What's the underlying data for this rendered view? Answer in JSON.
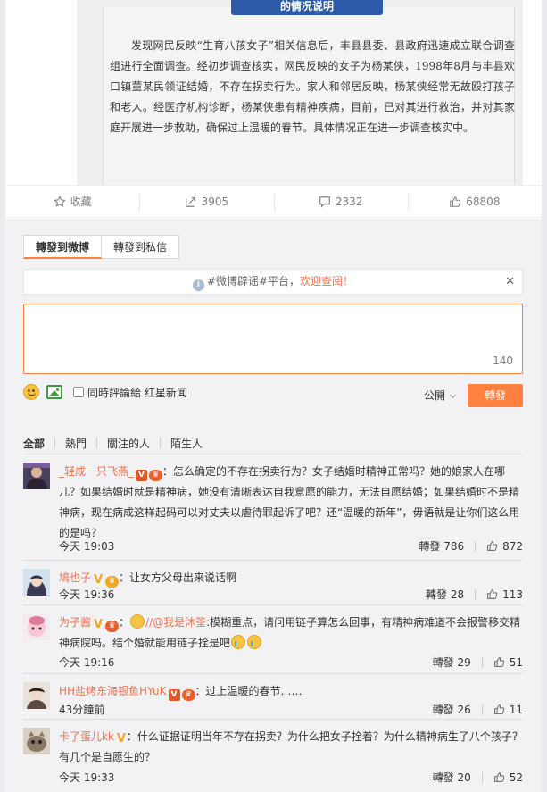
{
  "article_image": {
    "banner": "的情况说明",
    "text": "发现网民反映“生育八孩女子”相关信息后，丰县县委、县政府迅速成立联合调查组进行全面调查。经初步调查核实，网民反映的女子为杨某侠，1998年8月与丰县欢口镇董某民领证结婚，不存在拐卖行为。家人和邻居反映，杨某侠经常无故殴打孩子和老人。经医疗机构诊断，杨某侠患有精神疾病，目前，已对其进行救治，并对其家庭开展进一步救助，确保过上温暖的春节。具体情况正在进一步调查核实中。"
  },
  "actions": {
    "favorite": "收藏",
    "forward_count": "3905",
    "comment_count": "2332",
    "like_count": "68808"
  },
  "forward_panel": {
    "tabs": [
      "轉發到微博",
      "轉發到私信"
    ],
    "notice_prefix": "#微博辟谣#平台，",
    "notice_link": "欢迎查阅！",
    "counter": "140",
    "sync_label": "同時評論給 红星新闻",
    "visibility": "公開",
    "send_label": "轉發"
  },
  "filters": [
    "全部",
    "熱門",
    "關注的人",
    "陌生人"
  ],
  "comments": [
    {
      "user": "_轻成一只飞燕_",
      "text": "：怎么确定的不存在拐卖行为？女子结婚时精神正常吗？她的娘家人在哪儿？如果结婚时就是精神病，她没有清晰表达自我意愿的能力，无法自愿结婚；如果结婚时不是精神病，现在病成这样起码可以对丈夫以虐待罪起诉了吧？还“温暖的新年”，毋语就是让你们这么用的是吗？",
      "time": "今天 19:03",
      "reply_label": "轉發",
      "reply": "786",
      "likes": "872"
    },
    {
      "user": "鳩也子",
      "text": "：让女方父母出来说话啊",
      "time": "今天 19:36",
      "reply_label": "轉發",
      "reply": "28",
      "likes": "113"
    },
    {
      "user": "为子酱",
      "text_prefix": "：",
      "mention": "//@我是沐筌",
      "text": ":模糊重点，请问用链子算怎么回事，有精神病难道不会报警移交精神病院吗。结个婚就能用链子拴是吧",
      "time": "今天 19:16",
      "reply_label": "轉發",
      "reply": "29",
      "likes": "51"
    },
    {
      "user": "HH盐烤东海银鱼HYuK",
      "text": "：过上温暖的春节……",
      "time": "43分鐘前",
      "reply_label": "轉發",
      "reply": "26",
      "likes": "11"
    },
    {
      "user": "卡了蛋儿kk",
      "text": "：什么证据证明当年不存在拐卖？为什么把女子拴着？为什么精神病生了八个孩子？有几个是自愿生的？",
      "time": "今天 19:33",
      "reply_label": "轉發",
      "reply": "20",
      "likes": "52"
    }
  ],
  "colors": {
    "accent": "#ff8140",
    "username": "#eb7350",
    "banner": "#2a5aa8"
  }
}
